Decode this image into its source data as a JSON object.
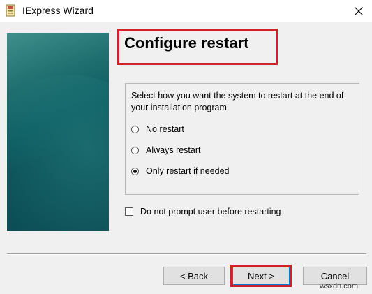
{
  "window": {
    "title": "IExpress Wizard",
    "close_icon": "close-icon",
    "app_icon": "iexpress-app-icon"
  },
  "page": {
    "title": "Configure restart"
  },
  "restart_options": {
    "prompt": "Select how you want the system to restart at the end of your installation program.",
    "options": [
      {
        "label": "No restart",
        "selected": false
      },
      {
        "label": "Always restart",
        "selected": false
      },
      {
        "label": "Only restart if needed",
        "selected": true
      }
    ]
  },
  "no_prompt_checkbox": {
    "label": "Do not prompt user before restarting",
    "checked": false
  },
  "buttons": {
    "back": "< Back",
    "next": "Next >",
    "cancel": "Cancel"
  },
  "watermark": "wsxdn.com",
  "colors": {
    "highlight": "#d0202a",
    "side_panel": "#0b5c61"
  }
}
